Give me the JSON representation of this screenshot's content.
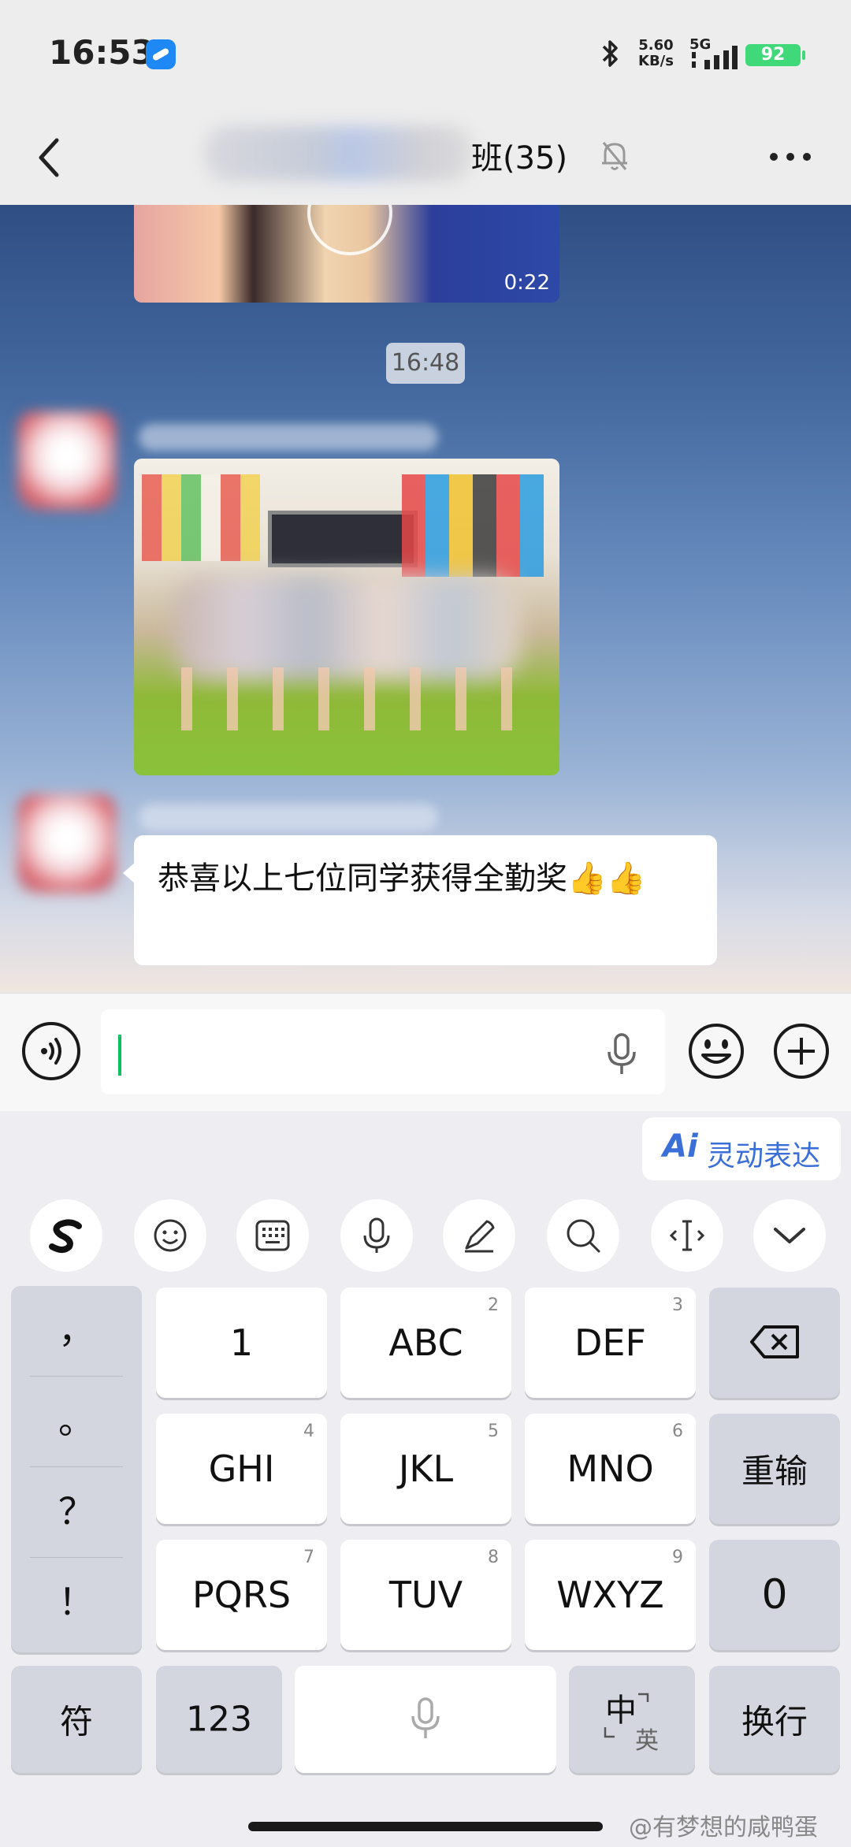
{
  "status_bar": {
    "time": "16:53",
    "speed_value": "5.60",
    "speed_unit": "KB/s",
    "network": "5G",
    "battery": "92"
  },
  "header": {
    "title_suffix": "班(35)"
  },
  "chat": {
    "video_duration": "0:22",
    "timestamp": "16:48",
    "message_text": "恭喜以上七位同学获得全勤奖👍👍"
  },
  "keyboard": {
    "ai_button": {
      "icon_text": "Ai",
      "label": "灵动表达"
    },
    "toolbar": [
      "sogou-logo",
      "emoji",
      "keyboard",
      "voice",
      "handwriting",
      "search",
      "cursor",
      "collapse"
    ],
    "symbols": [
      "，",
      "。",
      "？",
      "！"
    ],
    "keys": {
      "k1": {
        "label": "1"
      },
      "k2": {
        "label": "ABC",
        "num": "2"
      },
      "k3": {
        "label": "DEF",
        "num": "3"
      },
      "k4": {
        "label": "GHI",
        "num": "4"
      },
      "k5": {
        "label": "JKL",
        "num": "5"
      },
      "k6": {
        "label": "MNO",
        "num": "6"
      },
      "k7": {
        "label": "PQRS",
        "num": "7"
      },
      "k8": {
        "label": "TUV",
        "num": "8"
      },
      "k9": {
        "label": "WXYZ",
        "num": "9"
      },
      "k0": {
        "label": "0"
      },
      "reinput": "重输",
      "fu": "符",
      "num123": "123",
      "lang_main": "中",
      "lang_sub": "英",
      "enter": "换行"
    }
  },
  "watermark": "@有梦想的咸鸭蛋",
  "colors": {
    "accent_green": "#07C160",
    "battery_green": "#3FD97A",
    "ai_blue": "#3B6FD8"
  }
}
